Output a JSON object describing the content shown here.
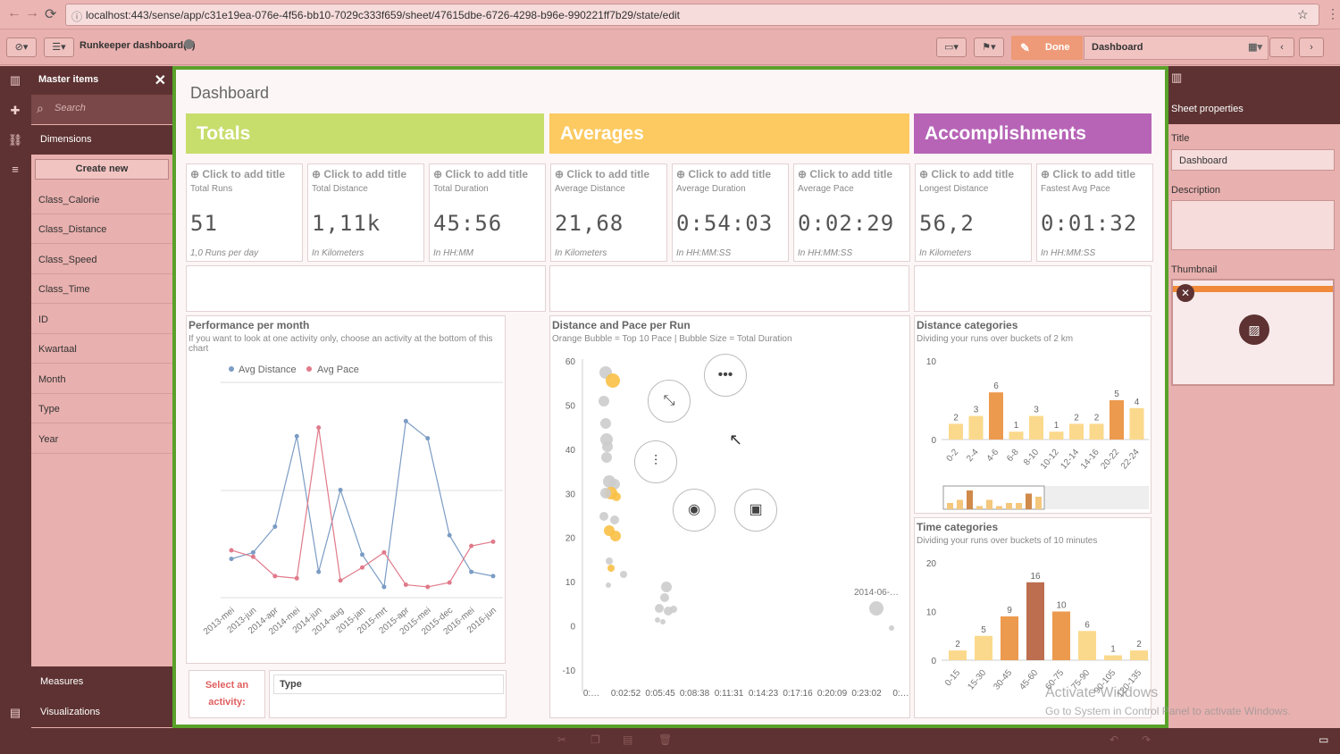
{
  "browser": {
    "url": "localhost:443/sense/app/c31e19ea-076e-4f56-bb10-7029c333f659/sheet/47615dbe-6726-4298-b96e-990221ff7b29/state/edit"
  },
  "toolbar": {
    "app_title": "Runkeeper dashboard(1)",
    "done_label": "Done",
    "sheet_name": "Dashboard"
  },
  "panel": {
    "title": "Master items",
    "search_placeholder": "Search",
    "dimensions_tab": "Dimensions",
    "create_new": "Create new",
    "items": [
      "Class_Calorie",
      "Class_Distance",
      "Class_Speed",
      "Class_Time",
      "ID",
      "Kwartaal",
      "Month",
      "Type",
      "Year"
    ],
    "measures": "Measures",
    "visualizations": "Visualizations"
  },
  "sheet": {
    "title": "Dashboard",
    "headers": [
      {
        "label": "Totals",
        "color": "#c7dd6c"
      },
      {
        "label": "Averages",
        "color": "#fcca61"
      },
      {
        "label": "Accomplishments",
        "color": "#b764b7"
      }
    ],
    "kpis": [
      {
        "title": "Click to add title",
        "sub": "Total Runs",
        "value": "51",
        "foot": "1,0 Runs per day"
      },
      {
        "title": "Click to add title",
        "sub": "Total Distance",
        "value": "1,11k",
        "foot": "In Kilometers"
      },
      {
        "title": "Click to add title",
        "sub": "Total Duration",
        "value": "45:56",
        "foot": "In HH:MM"
      },
      {
        "title": "Click to add title",
        "sub": "Average Distance",
        "value": "21,68",
        "foot": "In Kilometers"
      },
      {
        "title": "Click to add title",
        "sub": "Average Duration",
        "value": "0:54:03",
        "foot": "In HH:MM:SS"
      },
      {
        "title": "Click to add title",
        "sub": "Average Pace",
        "value": "0:02:29",
        "foot": "In HH:MM:SS"
      },
      {
        "title": "Click to add title",
        "sub": "Longest Distance",
        "value": "56,2",
        "foot": "In Kilometers"
      },
      {
        "title": "Click to add title",
        "sub": "Fastest Avg Pace",
        "value": "0:01:32",
        "foot": "In HH:MM:SS"
      }
    ],
    "select_activity": "Select an activity:",
    "type_label": "Type"
  },
  "charts": {
    "performance": {
      "title": "Performance per month",
      "sub": "If you want to look at one activity only, choose an activity at the bottom of this chart",
      "legend": [
        "Avg Distance",
        "Avg Pace"
      ],
      "colors": [
        "#7b9cc4",
        "#e07a8a"
      ]
    },
    "bubble": {
      "title": "Distance and Pace per Run",
      "sub": "Orange Bubble = Top 10 Pace | Bubble Size = Total Duration",
      "annotation": "2014-06-…"
    },
    "distance": {
      "title": "Distance categories",
      "sub": "Dividing your runs over buckets of 2 km"
    },
    "time": {
      "title": "Time categories",
      "sub": "Dividing your runs over buckets of 10 minutes"
    }
  },
  "chart_data": [
    {
      "type": "line",
      "title": "Performance per month",
      "categories": [
        "2013-mei",
        "2013-jun",
        "2014-apr",
        "2014-mei",
        "2014-jun",
        "2014-aug",
        "2015-jan",
        "2015-mrt",
        "2015-apr",
        "2015-mei",
        "2015-dec",
        "2016-mei",
        "2016-jun"
      ],
      "series": [
        {
          "name": "Avg Distance",
          "values": [
            0.18,
            0.21,
            0.33,
            0.75,
            0.12,
            0.5,
            0.2,
            0.05,
            0.82,
            0.74,
            0.29,
            0.12,
            0.1
          ]
        },
        {
          "name": "Avg Pace",
          "values": [
            0.22,
            0.19,
            0.1,
            0.09,
            0.79,
            0.08,
            0.14,
            0.21,
            0.06,
            0.05,
            0.07,
            0.24,
            0.26
          ]
        }
      ]
    },
    {
      "type": "scatter",
      "title": "Distance and Pace per Run",
      "ylim": [
        -10,
        60
      ],
      "y_ticks": [
        "60",
        "50",
        "40",
        "30",
        "20",
        "10",
        "0",
        "-10"
      ],
      "x_ticks": [
        "0:…",
        "0:02:52",
        "0:05:45",
        "0:08:38",
        "0:11:31",
        "0:14:23",
        "0:17:16",
        "0:20:09",
        "0:23:02",
        "0:…"
      ]
    },
    {
      "type": "bar",
      "title": "Distance categories",
      "ylim": [
        0,
        10
      ],
      "y_ticks": [
        "10",
        "0"
      ],
      "categories": [
        "0-2",
        "2-4",
        "4-6",
        "6-8",
        "8-10",
        "10-12",
        "12-14",
        "14-16",
        "20-22",
        "22-24"
      ],
      "values": [
        2,
        3,
        6,
        1,
        3,
        1,
        2,
        2,
        5,
        4
      ]
    },
    {
      "type": "bar",
      "title": "Time categories",
      "ylim": [
        0,
        20
      ],
      "y_ticks": [
        "20",
        "10",
        "0"
      ],
      "categories": [
        "0-15",
        "15-30",
        "30-45",
        "45-60",
        "60-75",
        "75-90",
        "90-105",
        "120-135"
      ],
      "values": [
        2,
        5,
        9,
        16,
        10,
        6,
        1,
        2
      ]
    }
  ],
  "props": {
    "heading": "Sheet properties",
    "title_label": "Title",
    "title_value": "Dashboard",
    "description_label": "Description",
    "thumbnail_label": "Thumbnail"
  },
  "watermark": {
    "line1": "Activate Windows",
    "line2": "Go to System in Control Panel to activate Windows."
  }
}
